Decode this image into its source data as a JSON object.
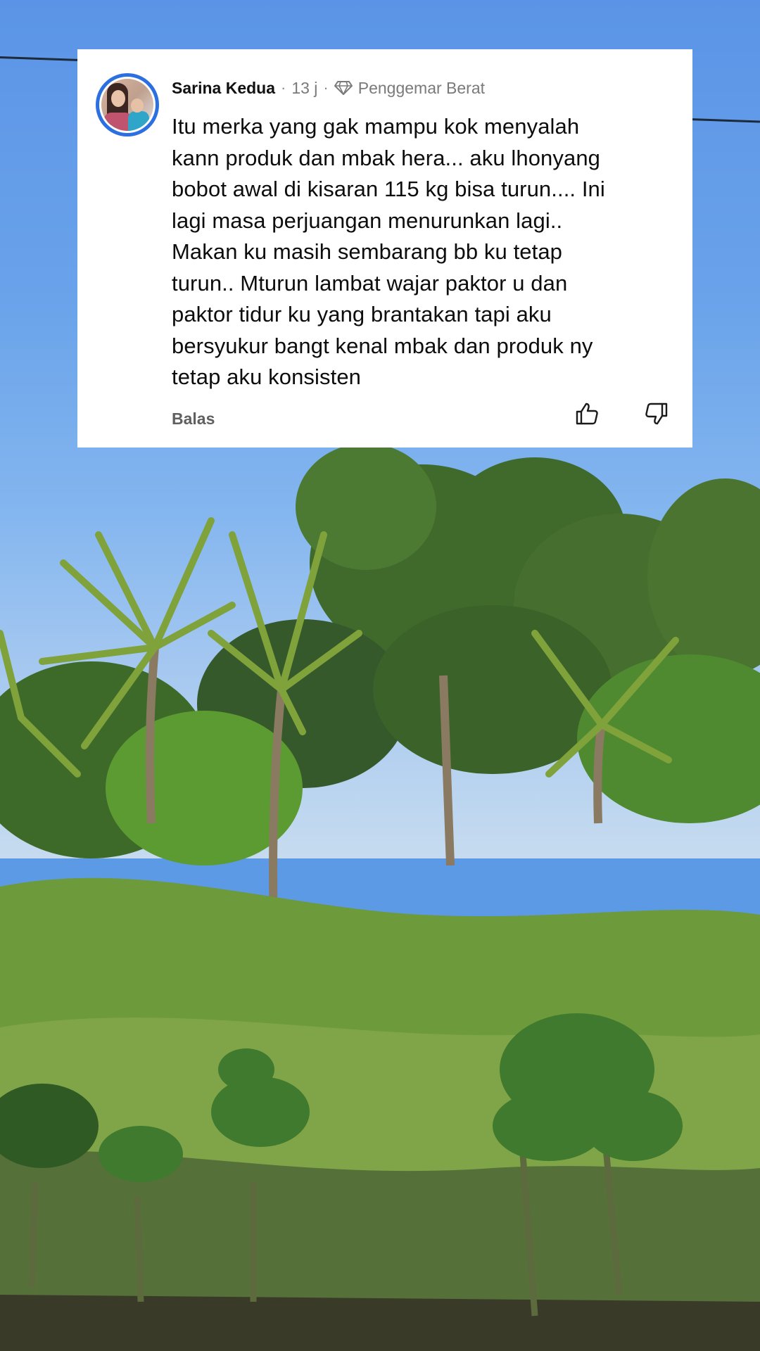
{
  "comment": {
    "author": "Sarina Kedua",
    "separator": "·",
    "time": "13 j",
    "badge": "Penggemar Berat",
    "text": "Itu merka yang gak mampu kok menyalah\nkann produk dan mbak hera... aku lhonyang\nbobot awal di kisaran 115 kg bisa turun.... Ini\nlagi masa perjuangan menurunkan lagi..\nMakan ku masih sembarang bb ku tetap\nturun.. Mturun lambat wajar paktor u dan\npaktor tidur ku yang brantakan tapi aku\nbersyukur bangt kenal mbak dan produk ny\ntetap aku konsisten",
    "reply_label": "Balas",
    "like_icon": "thumbs-up-icon",
    "dislike_icon": "thumbs-down-icon",
    "badge_icon": "diamond-icon"
  },
  "colors": {
    "avatar_ring": "#2b6fe0",
    "card_bg": "#ffffff",
    "sky": "#5d9ae6"
  }
}
